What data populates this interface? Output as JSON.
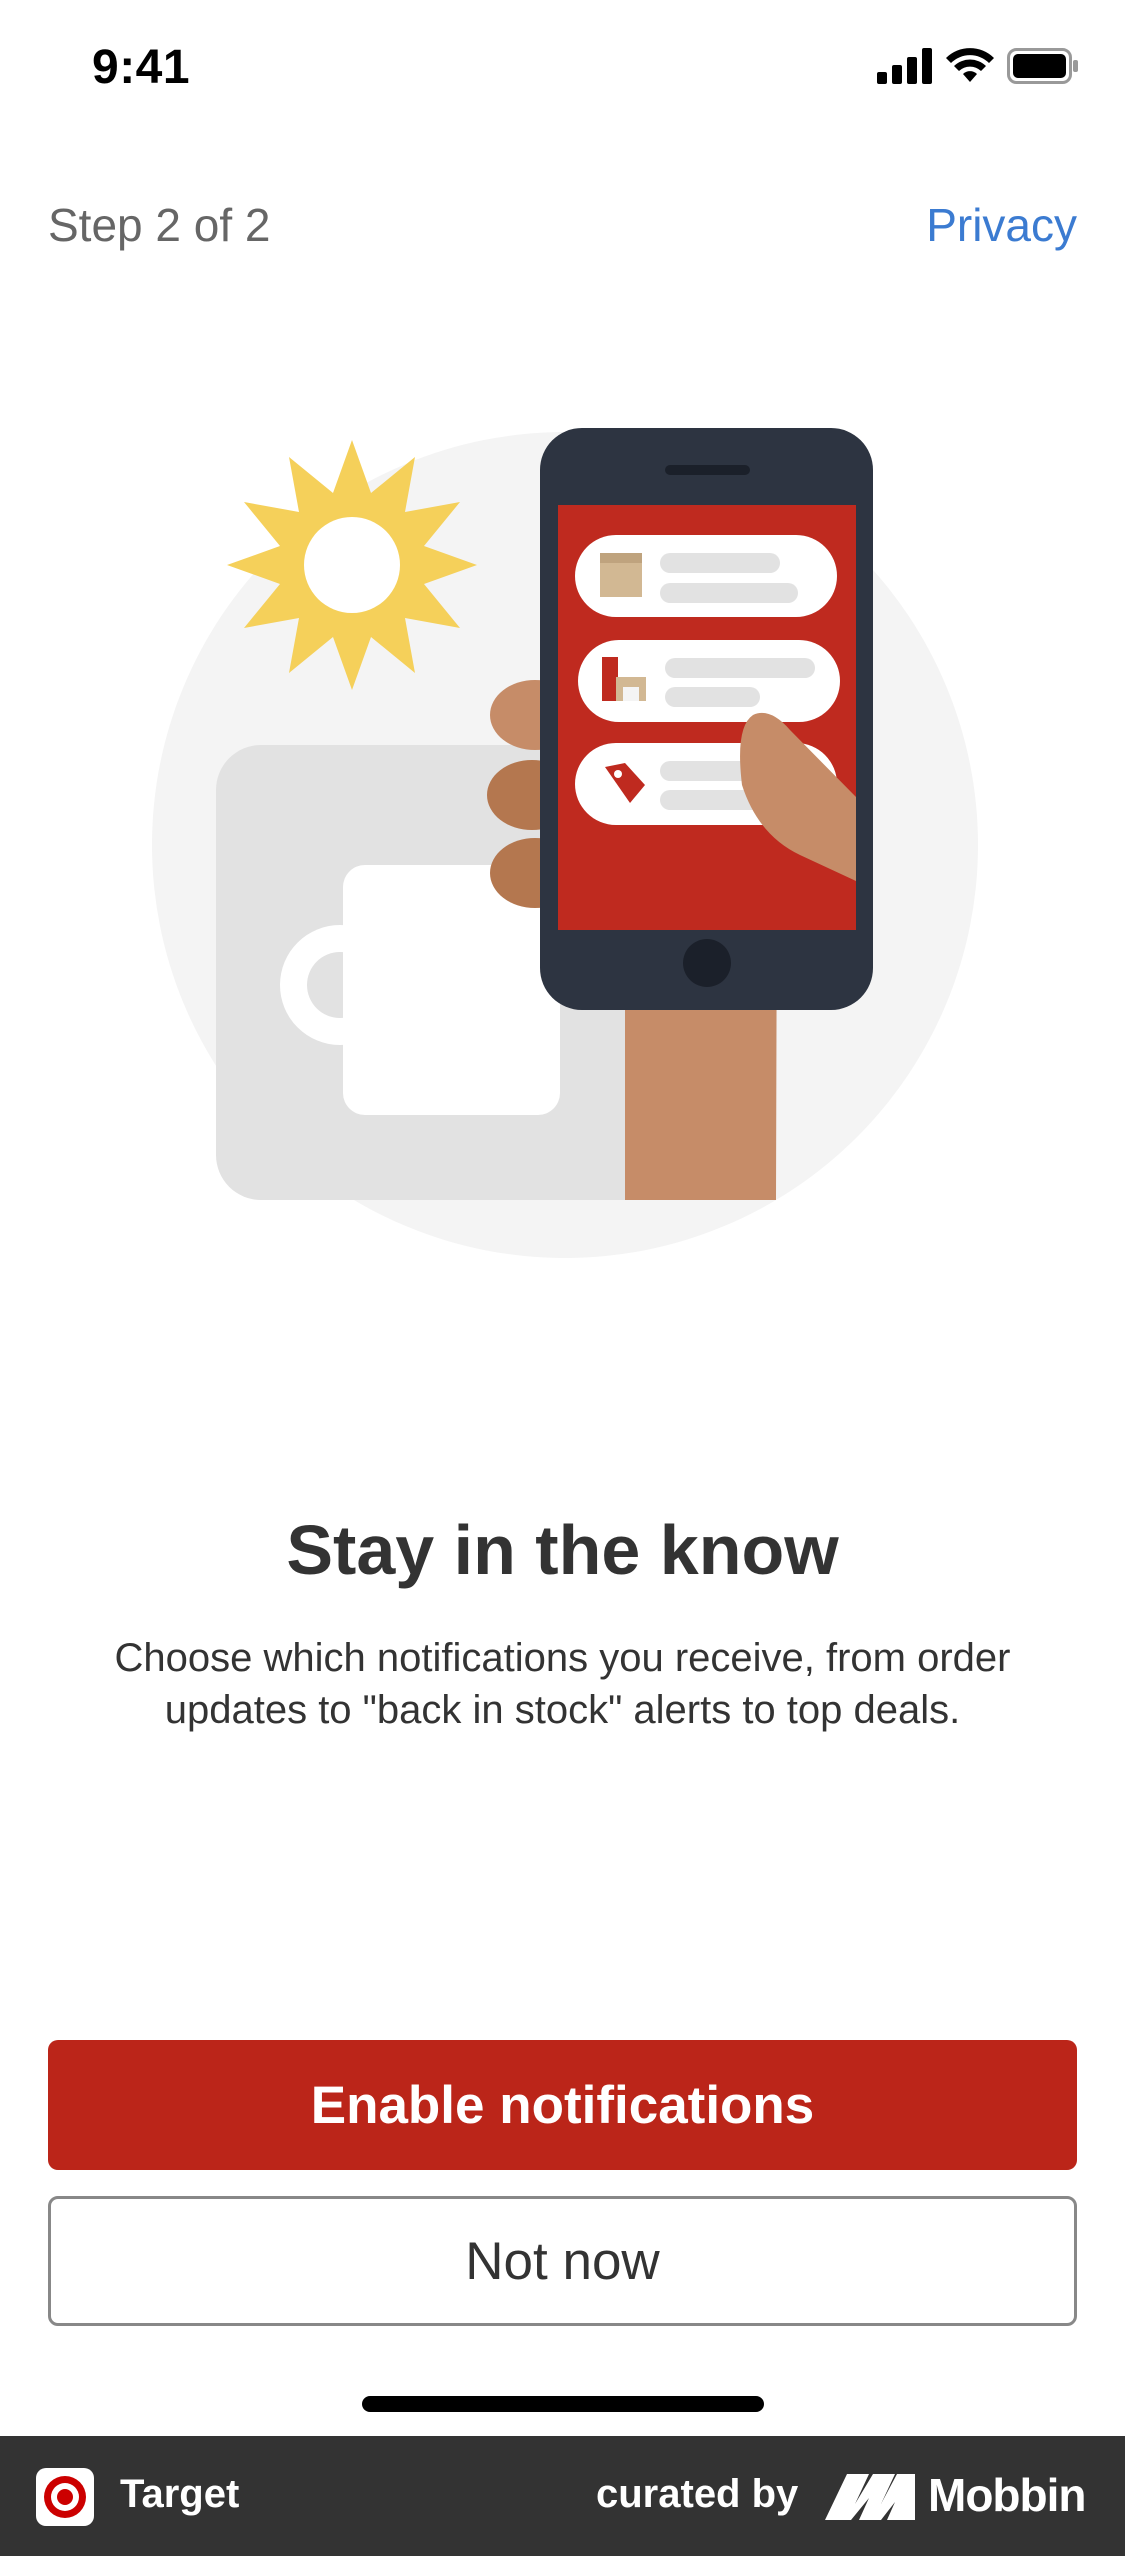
{
  "status_bar": {
    "time": "9:41"
  },
  "header": {
    "step": "Step 2 of 2",
    "privacy": "Privacy"
  },
  "content": {
    "title": "Stay in the know",
    "description": "Choose which notifications you receive, from order updates to \"back in stock\" alerts to top deals."
  },
  "actions": {
    "primary": "Enable notifications",
    "secondary": "Not now"
  },
  "footer": {
    "app_name": "Target",
    "curated_by": "curated by",
    "brand": "Mobbin"
  },
  "colors": {
    "accent_red": "#bb2519",
    "link_blue": "#3b7bd1",
    "footer_bg": "#333333",
    "sun_yellow": "#f5d05a",
    "skin_tone": "#c68c68"
  }
}
